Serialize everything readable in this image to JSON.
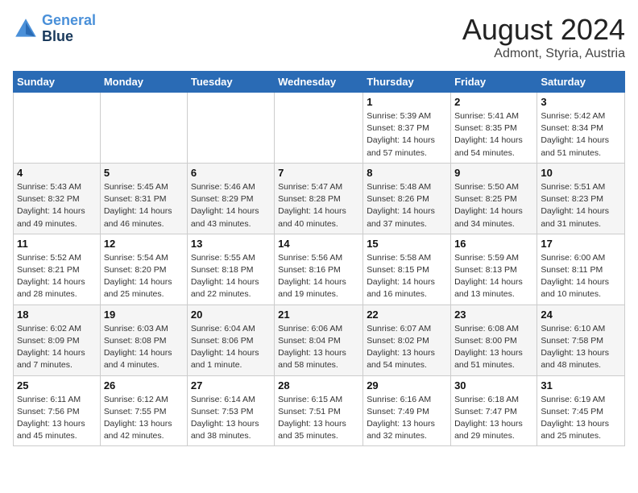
{
  "header": {
    "logo_line1": "General",
    "logo_line2": "Blue",
    "month_year": "August 2024",
    "location": "Admont, Styria, Austria"
  },
  "columns": [
    "Sunday",
    "Monday",
    "Tuesday",
    "Wednesday",
    "Thursday",
    "Friday",
    "Saturday"
  ],
  "weeks": [
    [
      {
        "day": "",
        "info": ""
      },
      {
        "day": "",
        "info": ""
      },
      {
        "day": "",
        "info": ""
      },
      {
        "day": "",
        "info": ""
      },
      {
        "day": "1",
        "info": "Sunrise: 5:39 AM\nSunset: 8:37 PM\nDaylight: 14 hours and 57 minutes."
      },
      {
        "day": "2",
        "info": "Sunrise: 5:41 AM\nSunset: 8:35 PM\nDaylight: 14 hours and 54 minutes."
      },
      {
        "day": "3",
        "info": "Sunrise: 5:42 AM\nSunset: 8:34 PM\nDaylight: 14 hours and 51 minutes."
      }
    ],
    [
      {
        "day": "4",
        "info": "Sunrise: 5:43 AM\nSunset: 8:32 PM\nDaylight: 14 hours and 49 minutes."
      },
      {
        "day": "5",
        "info": "Sunrise: 5:45 AM\nSunset: 8:31 PM\nDaylight: 14 hours and 46 minutes."
      },
      {
        "day": "6",
        "info": "Sunrise: 5:46 AM\nSunset: 8:29 PM\nDaylight: 14 hours and 43 minutes."
      },
      {
        "day": "7",
        "info": "Sunrise: 5:47 AM\nSunset: 8:28 PM\nDaylight: 14 hours and 40 minutes."
      },
      {
        "day": "8",
        "info": "Sunrise: 5:48 AM\nSunset: 8:26 PM\nDaylight: 14 hours and 37 minutes."
      },
      {
        "day": "9",
        "info": "Sunrise: 5:50 AM\nSunset: 8:25 PM\nDaylight: 14 hours and 34 minutes."
      },
      {
        "day": "10",
        "info": "Sunrise: 5:51 AM\nSunset: 8:23 PM\nDaylight: 14 hours and 31 minutes."
      }
    ],
    [
      {
        "day": "11",
        "info": "Sunrise: 5:52 AM\nSunset: 8:21 PM\nDaylight: 14 hours and 28 minutes."
      },
      {
        "day": "12",
        "info": "Sunrise: 5:54 AM\nSunset: 8:20 PM\nDaylight: 14 hours and 25 minutes."
      },
      {
        "day": "13",
        "info": "Sunrise: 5:55 AM\nSunset: 8:18 PM\nDaylight: 14 hours and 22 minutes."
      },
      {
        "day": "14",
        "info": "Sunrise: 5:56 AM\nSunset: 8:16 PM\nDaylight: 14 hours and 19 minutes."
      },
      {
        "day": "15",
        "info": "Sunrise: 5:58 AM\nSunset: 8:15 PM\nDaylight: 14 hours and 16 minutes."
      },
      {
        "day": "16",
        "info": "Sunrise: 5:59 AM\nSunset: 8:13 PM\nDaylight: 14 hours and 13 minutes."
      },
      {
        "day": "17",
        "info": "Sunrise: 6:00 AM\nSunset: 8:11 PM\nDaylight: 14 hours and 10 minutes."
      }
    ],
    [
      {
        "day": "18",
        "info": "Sunrise: 6:02 AM\nSunset: 8:09 PM\nDaylight: 14 hours and 7 minutes."
      },
      {
        "day": "19",
        "info": "Sunrise: 6:03 AM\nSunset: 8:08 PM\nDaylight: 14 hours and 4 minutes."
      },
      {
        "day": "20",
        "info": "Sunrise: 6:04 AM\nSunset: 8:06 PM\nDaylight: 14 hours and 1 minute."
      },
      {
        "day": "21",
        "info": "Sunrise: 6:06 AM\nSunset: 8:04 PM\nDaylight: 13 hours and 58 minutes."
      },
      {
        "day": "22",
        "info": "Sunrise: 6:07 AM\nSunset: 8:02 PM\nDaylight: 13 hours and 54 minutes."
      },
      {
        "day": "23",
        "info": "Sunrise: 6:08 AM\nSunset: 8:00 PM\nDaylight: 13 hours and 51 minutes."
      },
      {
        "day": "24",
        "info": "Sunrise: 6:10 AM\nSunset: 7:58 PM\nDaylight: 13 hours and 48 minutes."
      }
    ],
    [
      {
        "day": "25",
        "info": "Sunrise: 6:11 AM\nSunset: 7:56 PM\nDaylight: 13 hours and 45 minutes."
      },
      {
        "day": "26",
        "info": "Sunrise: 6:12 AM\nSunset: 7:55 PM\nDaylight: 13 hours and 42 minutes."
      },
      {
        "day": "27",
        "info": "Sunrise: 6:14 AM\nSunset: 7:53 PM\nDaylight: 13 hours and 38 minutes."
      },
      {
        "day": "28",
        "info": "Sunrise: 6:15 AM\nSunset: 7:51 PM\nDaylight: 13 hours and 35 minutes."
      },
      {
        "day": "29",
        "info": "Sunrise: 6:16 AM\nSunset: 7:49 PM\nDaylight: 13 hours and 32 minutes."
      },
      {
        "day": "30",
        "info": "Sunrise: 6:18 AM\nSunset: 7:47 PM\nDaylight: 13 hours and 29 minutes."
      },
      {
        "day": "31",
        "info": "Sunrise: 6:19 AM\nSunset: 7:45 PM\nDaylight: 13 hours and 25 minutes."
      }
    ]
  ]
}
